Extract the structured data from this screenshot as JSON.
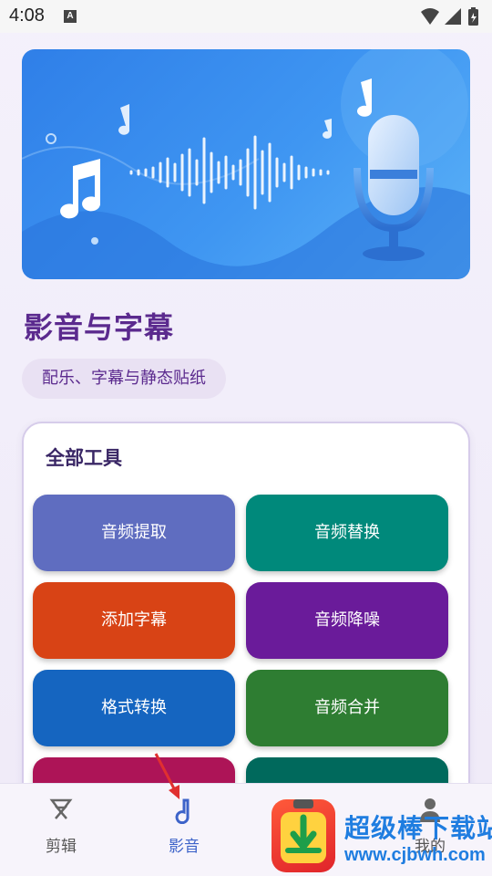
{
  "status_bar": {
    "time": "4:08",
    "notification_letter": "A"
  },
  "header": {
    "title": "影音与字幕",
    "subtitle": "配乐、字幕与静态贴纸"
  },
  "tools": {
    "title": "全部工具",
    "items": [
      {
        "label": "音频提取",
        "color": "#5f6dc0"
      },
      {
        "label": "音频替换",
        "color": "#00897b"
      },
      {
        "label": "添加字幕",
        "color": "#d84315"
      },
      {
        "label": "音频降噪",
        "color": "#6a1b9a"
      },
      {
        "label": "格式转换",
        "color": "#1565c0"
      },
      {
        "label": "音频合并",
        "color": "#2e7d32"
      },
      {
        "label": "",
        "color": "#ad1457"
      },
      {
        "label": "",
        "color": "#00695c"
      }
    ]
  },
  "nav": {
    "items": [
      {
        "label": "剪辑",
        "icon": "scissors-icon",
        "active": false
      },
      {
        "label": "影音",
        "icon": "music-note-icon",
        "active": true
      },
      {
        "label": "我的",
        "icon": "person-icon",
        "active": false
      }
    ]
  },
  "watermark": {
    "title": "超级棒下载站",
    "url": "www.cjbwh.com"
  },
  "colors": {
    "accent": "#5b2a8e",
    "nav_active": "#3d63c9",
    "banner": "#3f96f2"
  }
}
